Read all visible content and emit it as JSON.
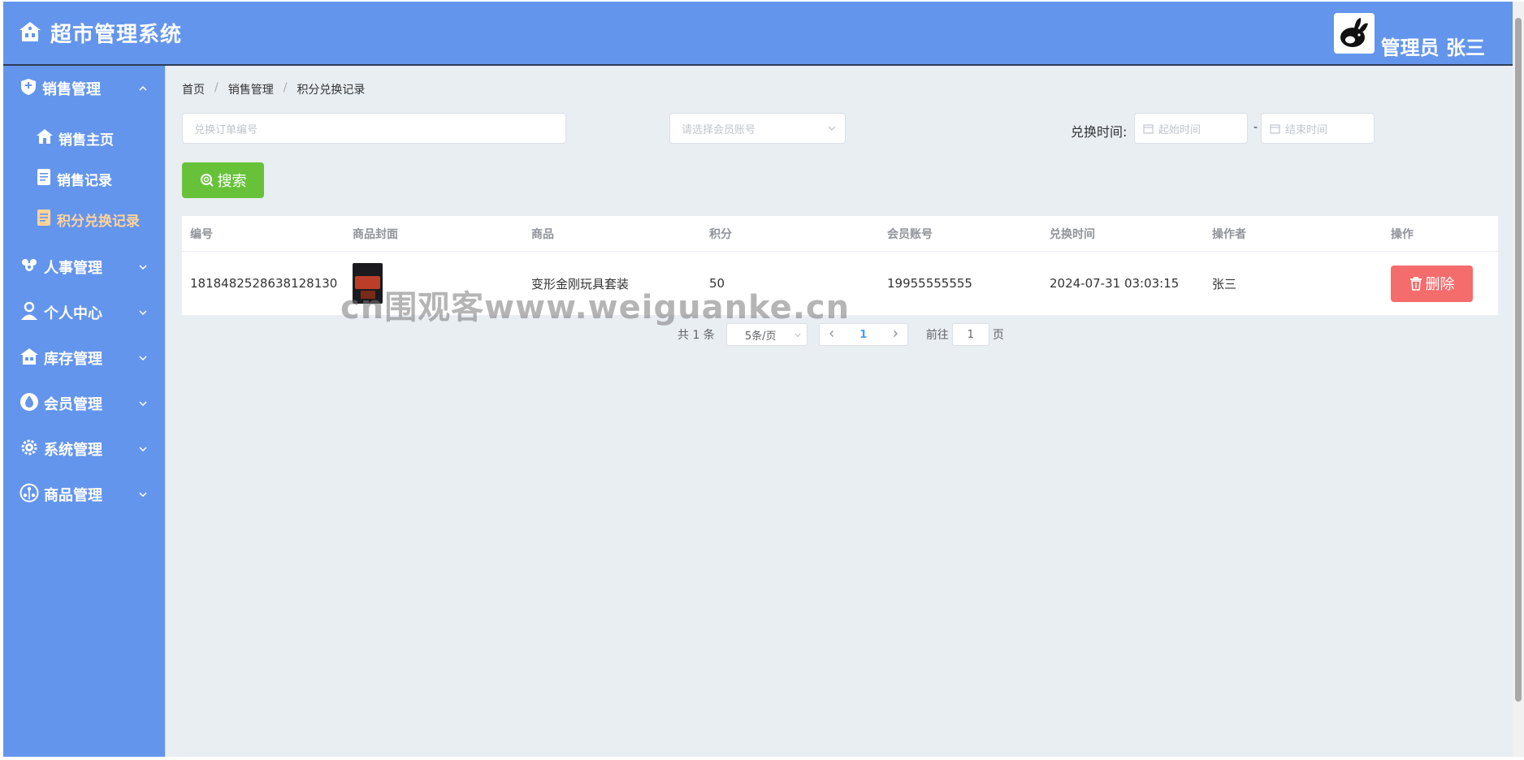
{
  "header": {
    "title": "超市管理系统",
    "user": "管理员 张三"
  },
  "sidebar": {
    "groups": [
      {
        "label": "销售管理",
        "expanded": true,
        "items": [
          "销售主页",
          "销售记录",
          "积分兑换记录"
        ]
      },
      {
        "label": "人事管理"
      },
      {
        "label": "个人中心"
      },
      {
        "label": "库存管理"
      },
      {
        "label": "会员管理"
      },
      {
        "label": "系统管理"
      },
      {
        "label": "商品管理"
      }
    ]
  },
  "breadcrumb": [
    "首页",
    "销售管理",
    "积分兑换记录"
  ],
  "filters": {
    "order_placeholder": "兑换订单编号",
    "member_placeholder": "请选择会员账号",
    "time_label": "兑换时间:",
    "start_placeholder": "起始时间",
    "end_placeholder": "结束时间",
    "range_sep": "-",
    "search_label": "搜索"
  },
  "table": {
    "columns": [
      "编号",
      "商品封面",
      "商品",
      "积分",
      "会员账号",
      "兑换时间",
      "操作者",
      "操作"
    ],
    "rows": [
      {
        "id": "1818482528638128130",
        "product": "变形金刚玩具套装",
        "points": "50",
        "member": "19955555555",
        "time": "2024-07-31 03:03:15",
        "operator": "张三",
        "action": "删除"
      }
    ]
  },
  "pagination": {
    "total": "共 1 条",
    "page_size": "5条/页",
    "current": "1",
    "goto_prefix": "前往",
    "goto_value": "1",
    "goto_suffix": "页"
  },
  "watermark": "cn围观客www.weiguanke.cn",
  "colors": {
    "primary": "#6495ed",
    "success": "#67c23a",
    "danger": "#f56c6c",
    "active_menu": "#ffd39a"
  }
}
